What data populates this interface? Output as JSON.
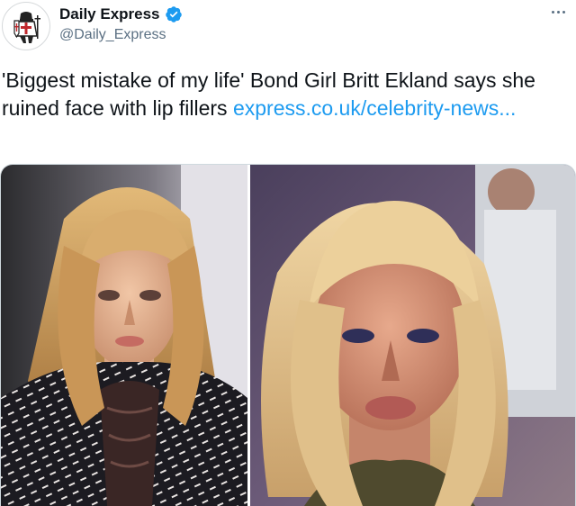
{
  "author": {
    "display_name": "Daily Express",
    "handle": "@Daily_Express",
    "verified": true,
    "avatar_icon": "crusader-knight-logo-icon",
    "verified_icon": "verified-badge-icon",
    "more_icon": "more-options-icon"
  },
  "tweet": {
    "text": "'Biggest mistake of my life' Bond Girl Britt Ekland says she ruined face with lip fillers ",
    "link_text": "express.co.uk/celebrity-news..."
  },
  "colors": {
    "link": "#1d9bf0",
    "secondary_text": "#5b7083",
    "verified": "#1d9bf0",
    "text": "#0f1419"
  }
}
